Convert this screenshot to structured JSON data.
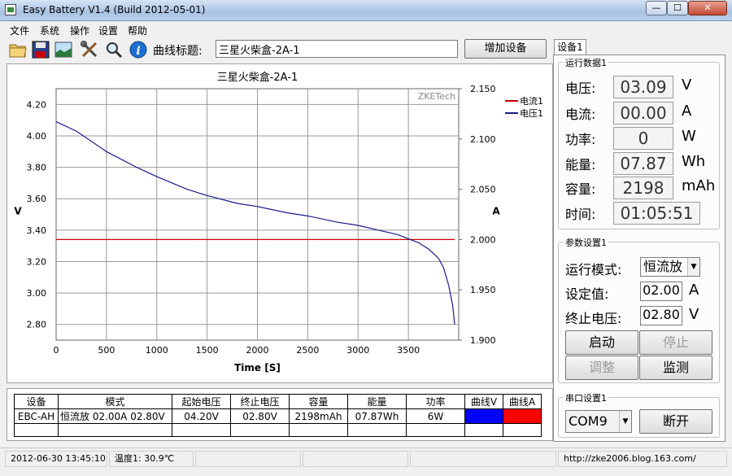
{
  "window": {
    "title": "Easy Battery V1.4 (Build 2012-05-01)",
    "min": "—",
    "max": "☐",
    "close": "✕"
  },
  "menu": [
    "文件",
    "系统",
    "操作",
    "设置",
    "帮助"
  ],
  "toolbar": {
    "icons": [
      "open-folder-icon",
      "save-icon",
      "chart-image-icon",
      "tools-icon",
      "zoom-icon",
      "info-icon"
    ],
    "curve_title_label": "曲线标题:",
    "curve_title_value": "三星火柴盒-2A-1",
    "add_device": "增加设备"
  },
  "chart_data": {
    "type": "line",
    "title": "三星火柴盒-2A-1",
    "watermark": "ZKETech",
    "xlabel": "Time [S]",
    "ylabel_left": "V",
    "ylabel_right": "A",
    "xlim": [
      0,
      4000
    ],
    "ylim_left": [
      2.7,
      4.3
    ],
    "ylim_right": [
      1.9,
      2.15
    ],
    "x_ticks": [
      "0",
      "500",
      "1000",
      "1500",
      "2000",
      "2500",
      "3000",
      "3500"
    ],
    "y_left_ticks": [
      "4.20",
      "4.00",
      "3.80",
      "3.60",
      "3.40",
      "3.20",
      "3.00",
      "2.80"
    ],
    "y_right_ticks": [
      "2.150",
      "2.100",
      "2.050",
      "2.000",
      "1.950",
      "1.900"
    ],
    "legend_position": "top-right",
    "grid": true,
    "series": [
      {
        "name": "电流1",
        "color": "#cc0000",
        "axis": "right",
        "x": [
          0,
          3960
        ],
        "values": [
          2.0,
          2.0
        ]
      },
      {
        "name": "电压1",
        "color": "#1a1a8c",
        "axis": "left",
        "x": [
          0,
          200,
          500,
          800,
          1000,
          1300,
          1500,
          1800,
          2000,
          2300,
          2500,
          2800,
          3000,
          3200,
          3400,
          3500,
          3600,
          3700,
          3800,
          3850,
          3900,
          3940,
          3960
        ],
        "values": [
          4.09,
          4.03,
          3.9,
          3.8,
          3.74,
          3.66,
          3.62,
          3.57,
          3.55,
          3.51,
          3.49,
          3.45,
          3.43,
          3.4,
          3.37,
          3.345,
          3.32,
          3.28,
          3.22,
          3.16,
          3.05,
          2.92,
          2.8
        ]
      }
    ]
  },
  "table": {
    "headers": [
      "设备",
      "模式",
      "起始电压",
      "终止电压",
      "容量",
      "能量",
      "功率",
      "曲线V",
      "曲线A"
    ],
    "rows": [
      {
        "device": "EBC-AH",
        "mode": "恒流放  02.00A  02.80V",
        "start_v": "04.20V",
        "end_v": "02.80V",
        "capacity": "2198mAh",
        "energy": "07.87Wh",
        "power": "6W",
        "curve_v_color": "#0000ff",
        "curve_a_color": "#ff0000"
      }
    ]
  },
  "status": {
    "datetime": "2012-06-30 13:45:10",
    "temperature": "温度1: 30.9℃",
    "url": "http://zke2006.blog.163.com/"
  },
  "tab": {
    "label": "设备1"
  },
  "run_data": {
    "title": "运行数据1",
    "rows": [
      {
        "label": "电压:",
        "value": "03.09",
        "unit": "V"
      },
      {
        "label": "电流:",
        "value": "00.00",
        "unit": "A"
      },
      {
        "label": "功率:",
        "value": "0",
        "unit": "W"
      },
      {
        "label": "能量:",
        "value": "07.87",
        "unit": "Wh"
      },
      {
        "label": "容量:",
        "value": "2198",
        "unit": "mAh"
      },
      {
        "label": "时间:",
        "value": "01:05:51",
        "unit": ""
      }
    ]
  },
  "params": {
    "title": "参数设置1",
    "mode_label": "运行模式:",
    "mode_value": "恒流放",
    "set_label": "设定值:",
    "set_value": "02.00",
    "set_unit": "A",
    "end_label": "终止电压:",
    "end_value": "02.80",
    "end_unit": "V",
    "start": "启动",
    "stop": "停止",
    "adjust": "调整",
    "monitor": "监测"
  },
  "serial": {
    "title": "串口设置1",
    "port": "COM9",
    "disconnect": "断开"
  }
}
